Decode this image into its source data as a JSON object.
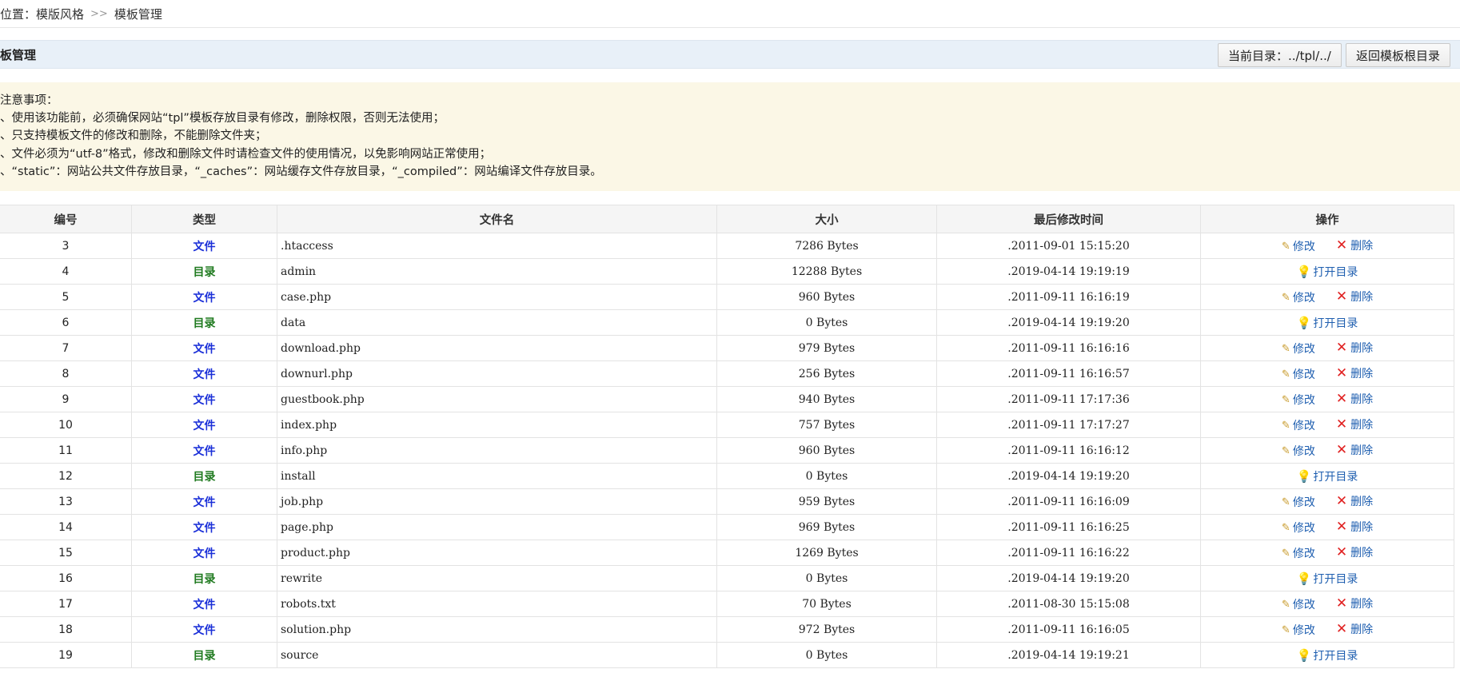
{
  "breadcrumb": {
    "prefix": "位置：",
    "first": "模版风格",
    "separator": ">>",
    "second": "模板管理"
  },
  "panel": {
    "title": "板管理",
    "current_dir_button": "当前目录：../tpl/../",
    "back_button": "返回模板根目录"
  },
  "notice": {
    "heading": "注意事项：",
    "lines": [
      "、使用该功能前，必须确保网站“tpl”模板存放目录有修改，删除权限，否则无法使用；",
      "、只支持模板文件的修改和删除，不能删除文件夹；",
      "、文件必须为“utf-8”格式，修改和删除文件时请检查文件的使用情况，以免影响网站正常使用；",
      "、“static”：网站公共文件存放目录，“_caches”：网站缓存文件存放目录，“_compiled”：网站编译文件存放目录。"
    ]
  },
  "table": {
    "headers": [
      "编号",
      "类型",
      "文件名",
      "大小",
      "最后修改时间",
      "操作"
    ],
    "labels": {
      "file": "文件",
      "dir": "目录",
      "edit": "修改",
      "delete": "删除",
      "open": "打开目录"
    },
    "rows": [
      {
        "id": "3",
        "type": "file",
        "name": ".htaccess",
        "size": "7286 Bytes",
        "mtime": ".2011-09-01 15:15:20"
      },
      {
        "id": "4",
        "type": "dir",
        "name": "admin",
        "size": "12288 Bytes",
        "mtime": ".2019-04-14 19:19:19"
      },
      {
        "id": "5",
        "type": "file",
        "name": "case.php",
        "size": "960 Bytes",
        "mtime": ".2011-09-11 16:16:19"
      },
      {
        "id": "6",
        "type": "dir",
        "name": "data",
        "size": "0 Bytes",
        "mtime": ".2019-04-14 19:19:20"
      },
      {
        "id": "7",
        "type": "file",
        "name": "download.php",
        "size": "979 Bytes",
        "mtime": ".2011-09-11 16:16:16"
      },
      {
        "id": "8",
        "type": "file",
        "name": "downurl.php",
        "size": "256 Bytes",
        "mtime": ".2011-09-11 16:16:57"
      },
      {
        "id": "9",
        "type": "file",
        "name": "guestbook.php",
        "size": "940 Bytes",
        "mtime": ".2011-09-11 17:17:36"
      },
      {
        "id": "10",
        "type": "file",
        "name": "index.php",
        "size": "757 Bytes",
        "mtime": ".2011-09-11 17:17:27"
      },
      {
        "id": "11",
        "type": "file",
        "name": "info.php",
        "size": "960 Bytes",
        "mtime": ".2011-09-11 16:16:12"
      },
      {
        "id": "12",
        "type": "dir",
        "name": "install",
        "size": "0 Bytes",
        "mtime": ".2019-04-14 19:19:20"
      },
      {
        "id": "13",
        "type": "file",
        "name": "job.php",
        "size": "959 Bytes",
        "mtime": ".2011-09-11 16:16:09"
      },
      {
        "id": "14",
        "type": "file",
        "name": "page.php",
        "size": "969 Bytes",
        "mtime": ".2011-09-11 16:16:25"
      },
      {
        "id": "15",
        "type": "file",
        "name": "product.php",
        "size": "1269 Bytes",
        "mtime": ".2011-09-11 16:16:22"
      },
      {
        "id": "16",
        "type": "dir",
        "name": "rewrite",
        "size": "0 Bytes",
        "mtime": ".2019-04-14 19:19:20"
      },
      {
        "id": "17",
        "type": "file",
        "name": "robots.txt",
        "size": "70 Bytes",
        "mtime": ".2011-08-30 15:15:08"
      },
      {
        "id": "18",
        "type": "file",
        "name": "solution.php",
        "size": "972 Bytes",
        "mtime": ".2011-09-11 16:16:05"
      },
      {
        "id": "19",
        "type": "dir",
        "name": "source",
        "size": "0 Bytes",
        "mtime": ".2019-04-14 19:19:21"
      }
    ]
  },
  "colors": {
    "file_type": "#1a2fd8",
    "dir_type": "#1f7a1f",
    "action_link": "#1f5fb0",
    "delete_icon": "#e02020",
    "header_bg": "#e8f0f8",
    "notice_bg": "#fbf7e6"
  },
  "icons": {
    "edit": "pencil-icon",
    "delete": "x-icon",
    "open": "lightbulb-icon",
    "breadcrumb_separator": "double-chevron-icon"
  }
}
